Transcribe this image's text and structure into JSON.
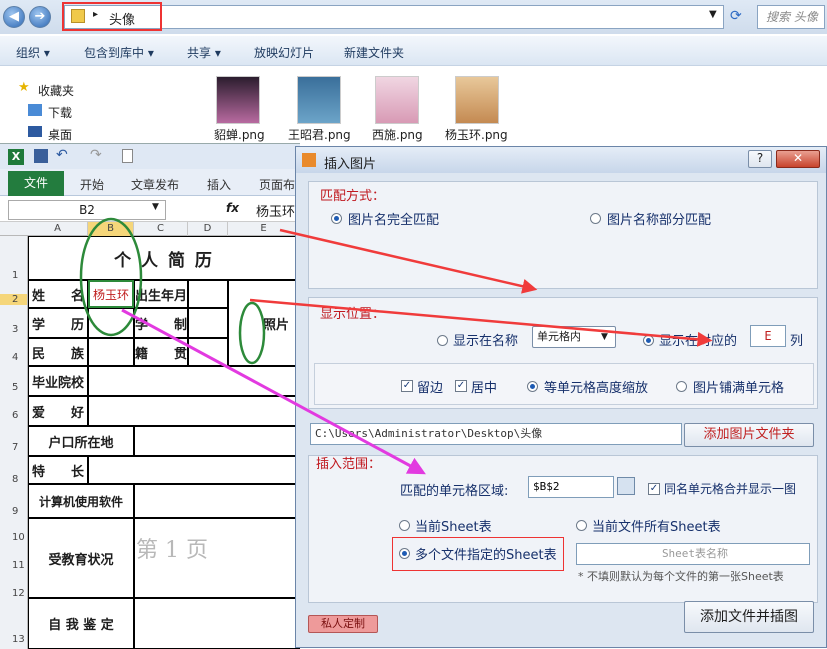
{
  "explorer": {
    "path": "头像",
    "search_placeholder": "搜索 头像",
    "commands": [
      "组织 ▾",
      "包含到库中 ▾",
      "共享 ▾",
      "放映幻灯片",
      "新建文件夹"
    ],
    "nav": [
      "收藏夹",
      "下载",
      "桌面"
    ],
    "files": [
      {
        "name": "貂蝉.png",
        "color": "#b86aa0"
      },
      {
        "name": "王昭君.png",
        "color": "#6ca4c8"
      },
      {
        "name": "西施.png",
        "color": "#d89ab5"
      },
      {
        "name": "杨玉环.png",
        "color": "#c48a52"
      }
    ]
  },
  "excel": {
    "tabs": [
      "文件",
      "开始",
      "文章发布",
      "插入",
      "页面布"
    ],
    "namebox": "B2",
    "formula": "杨玉环",
    "columns": [
      "A",
      "B",
      "C",
      "D",
      "E"
    ],
    "rows": [
      "1",
      "2",
      "3",
      "4",
      "5",
      "6",
      "7",
      "8",
      "9",
      "10",
      "11",
      "12",
      "13"
    ],
    "sheet": {
      "title": "个 人 简 历",
      "name_label": "姓　　名",
      "name_value": "杨玉环",
      "birth_label": "出生年月",
      "edu_label": "学　　历",
      "school_system_label": "学　　制",
      "ethnicity_label": "民　　族",
      "origin_label": "籍　　贯",
      "college_label": "毕业院校",
      "hobby_label": "爱　　好",
      "hukou_label": "户口所在地",
      "skill_label": "特　　长",
      "software_label": "计算机使用软件",
      "education_label": "受教育状况",
      "page_watermark": "第 1 页",
      "self_eval_label": "自 我 鉴 定",
      "photo_label": "照片"
    }
  },
  "dialog": {
    "title": "插入图片",
    "help": "?",
    "close": "✕",
    "match_group": "匹配方式：",
    "match_exact": "图片名完全匹配",
    "match_partial": "图片名称部分匹配",
    "position_group": "显示位置：",
    "show_in_name": "显示在名称",
    "name_dropdown": "单元格内",
    "show_in_column": "显示在对应的",
    "column_value": "E",
    "column_suffix": "列",
    "margin": "留边",
    "center": "居中",
    "scale_equal_height": "等单元格高度缩放",
    "fill_cell": "图片铺满单元格",
    "folder_path": "C:\\Users\\Administrator\\Desktop\\头像",
    "add_folder": "添加图片文件夹",
    "range_group": "插入范围：",
    "cell_range_label": "匹配的单元格区域:",
    "cell_range_value": "$B$2",
    "merge_same": "同名单元格合并显示一图",
    "current_sheet": "当前Sheet表",
    "all_sheets": "当前文件所有Sheet表",
    "multi_files": "多个文件指定的Sheet表",
    "sheet_name_placeholder": "Sheet表名称",
    "sheet_hint": "* 不填则默认为每个文件的第一张Sheet表",
    "custom": "私人定制",
    "add_files": "添加文件并插图"
  }
}
